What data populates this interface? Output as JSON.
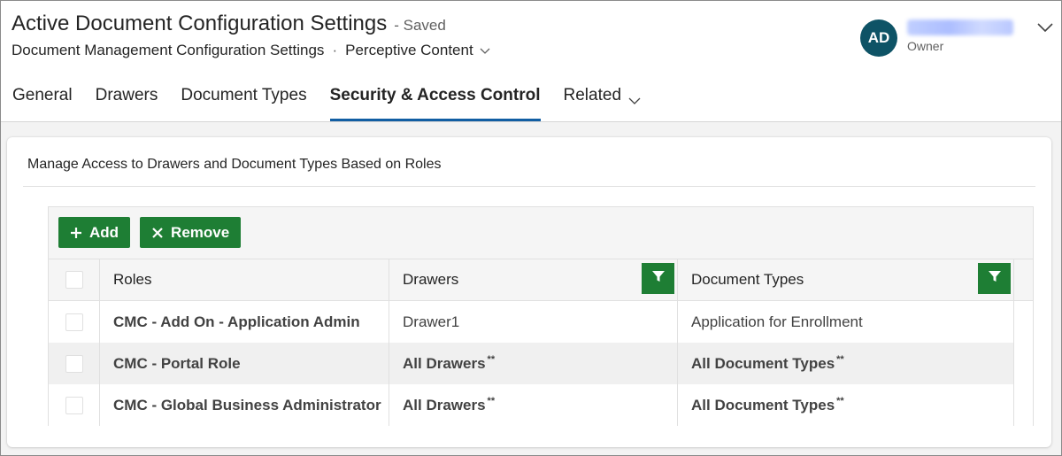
{
  "header": {
    "title": "Active Document Configuration Settings",
    "saved_status": "- Saved",
    "entity": "Document Management Configuration Settings",
    "separator": "·",
    "form_selector": "Perceptive Content"
  },
  "owner": {
    "initials": "AD",
    "name": "",
    "role": "Owner",
    "avatar_color": "#0e5366"
  },
  "tabs": [
    {
      "label": "General"
    },
    {
      "label": "Drawers"
    },
    {
      "label": "Document Types"
    },
    {
      "label": "Security & Access Control",
      "active": true
    },
    {
      "label": "Related"
    }
  ],
  "section": {
    "title": "Manage Access to Drawers and Document Types Based on Roles"
  },
  "toolbar": {
    "add_label": "Add",
    "remove_label": "Remove",
    "button_color": "#1e7e34"
  },
  "grid": {
    "columns": [
      "Roles",
      "Drawers",
      "Document Types"
    ],
    "rows": [
      {
        "role": "CMC - Add On - Application Admin",
        "drawers": "Drawer1",
        "drawers_sup": "",
        "doc_types": "Application for Enrollment",
        "doc_types_sup": ""
      },
      {
        "role": "CMC - Portal Role",
        "drawers": "All Drawers",
        "drawers_sup": "**",
        "doc_types": "All Document Types",
        "doc_types_sup": "**"
      },
      {
        "role": "CMC - Global Business Administrator",
        "drawers": "All Drawers",
        "drawers_sup": "**",
        "doc_types": "All Document Types",
        "doc_types_sup": "**"
      }
    ]
  },
  "icons": {
    "add": "plus-icon",
    "remove": "x-icon",
    "filter": "filter-icon",
    "expand": "chevron-down-icon"
  },
  "colors": {
    "active_tab_underline": "#115ea3"
  }
}
